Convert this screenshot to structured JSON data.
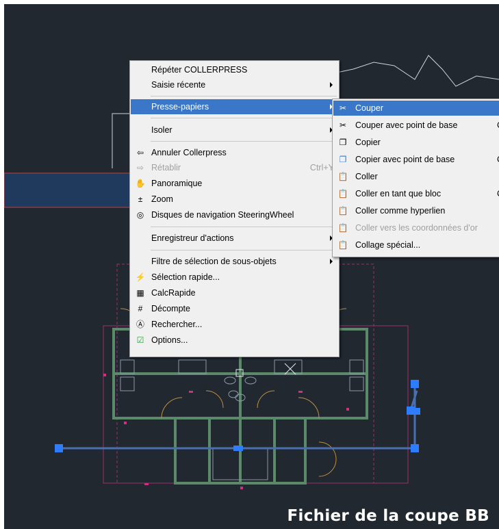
{
  "main_menu": {
    "items": [
      {
        "label": "Répéter COLLERPRESS"
      },
      {
        "label": "Saisie récente"
      },
      {
        "label": "Presse-papiers"
      },
      {
        "label": "Isoler"
      },
      {
        "label": "Annuler Collerpress"
      },
      {
        "label": "Rétablir",
        "shortcut": "Ctrl+Y"
      },
      {
        "label": "Panoramique"
      },
      {
        "label": "Zoom"
      },
      {
        "label": "Disques de navigation SteeringWheel"
      },
      {
        "label": "Enregistreur d'actions"
      },
      {
        "label": "Filtre de sélection de sous-objets"
      },
      {
        "label": "Sélection rapide..."
      },
      {
        "label": "CalcRapide"
      },
      {
        "label": "Décompte"
      },
      {
        "label": "Rechercher..."
      },
      {
        "label": "Options..."
      }
    ]
  },
  "sub_menu": {
    "items": [
      {
        "label": "Couper"
      },
      {
        "label": "Couper avec point de base",
        "trunc": "C"
      },
      {
        "label": "Copier"
      },
      {
        "label": "Copier avec point de base",
        "trunc": "C"
      },
      {
        "label": "Coller"
      },
      {
        "label": "Coller en tant que bloc",
        "trunc": "C"
      },
      {
        "label": "Coller comme hyperlien"
      },
      {
        "label": "Coller vers les coordonnées d'or"
      },
      {
        "label": "Collage spécial..."
      }
    ]
  },
  "caption": "Fichier de la coupe BB",
  "colors": {
    "background": "#212830",
    "highlight": "#3a77c8",
    "wall": "#5a8a6a",
    "selection_band": "#1f3a5c",
    "grip": "#2e7dff"
  }
}
